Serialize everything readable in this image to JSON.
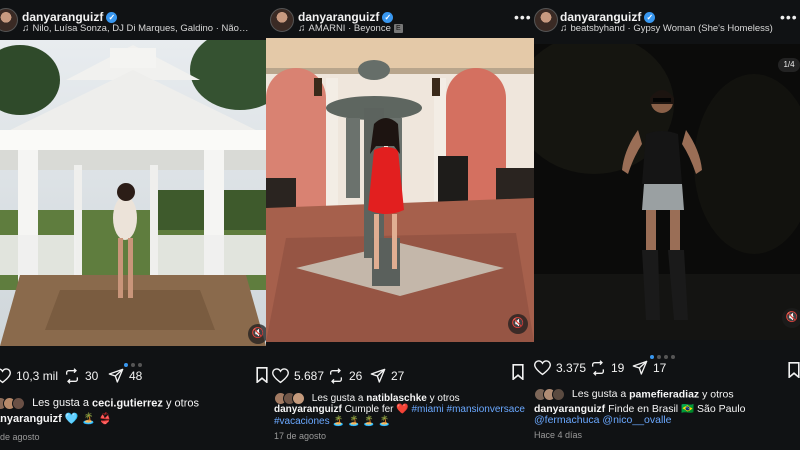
{
  "posts": [
    {
      "username": "danyaranguizf",
      "audio": "Nilo, Luísa Sonza, DJ Di Marques, Galdino · Não…",
      "likes": "10,3 mil",
      "reposts": "30",
      "shares": "48",
      "liked_prefix": "Les gusta a ",
      "liked_user": "ceci.gutierrez",
      "liked_suffix": " y otros",
      "caption_user": "anyaranguizf",
      "caption_emojis": "🩵 🏝️ 👙",
      "date": "de agosto",
      "mute_icon": "speaker-muted-icon"
    },
    {
      "username": "danyaranguizf",
      "audio_artist": "AMARNI · Beyonce",
      "explicit_badge": "E",
      "likes": "5.687",
      "reposts": "26",
      "shares": "27",
      "liked_prefix": "Les gusta a ",
      "liked_user": "natiblaschke",
      "liked_suffix": " y otros",
      "caption_user": "danyaranguizf",
      "caption_text": "Cumple fer",
      "caption_heart": "❤️",
      "caption_tags": "#miami #mansionversace",
      "caption_tags2": "#vacaciones",
      "caption_emojis": "🏝️ 🏝️ 🏝️ 🏝️",
      "date": "17 de agosto"
    },
    {
      "username": "danyaranguizf",
      "audio": "beatsbyhand · Gypsy Woman (She's Homeless) [...",
      "counter": "1/4",
      "likes": "3.375",
      "reposts": "19",
      "shares": "17",
      "liked_prefix": "Les gusta a ",
      "liked_user": "pamefieradiaz",
      "liked_suffix": " y otros",
      "caption_user": "danyaranguizf",
      "caption_text": "Finde en Brasil 🇧🇷 São Paulo",
      "caption_mentions": "@fermachuca @nico__ovalle",
      "date": "Hace 4 días"
    }
  ],
  "colors": {
    "accent": "#3897f0",
    "background": "#101214",
    "tag": "#6aa8ff"
  },
  "icons": [
    "heart-icon",
    "repost-icon",
    "share-icon",
    "bookmark-icon",
    "music-note-icon",
    "verified-icon",
    "more-icon"
  ]
}
